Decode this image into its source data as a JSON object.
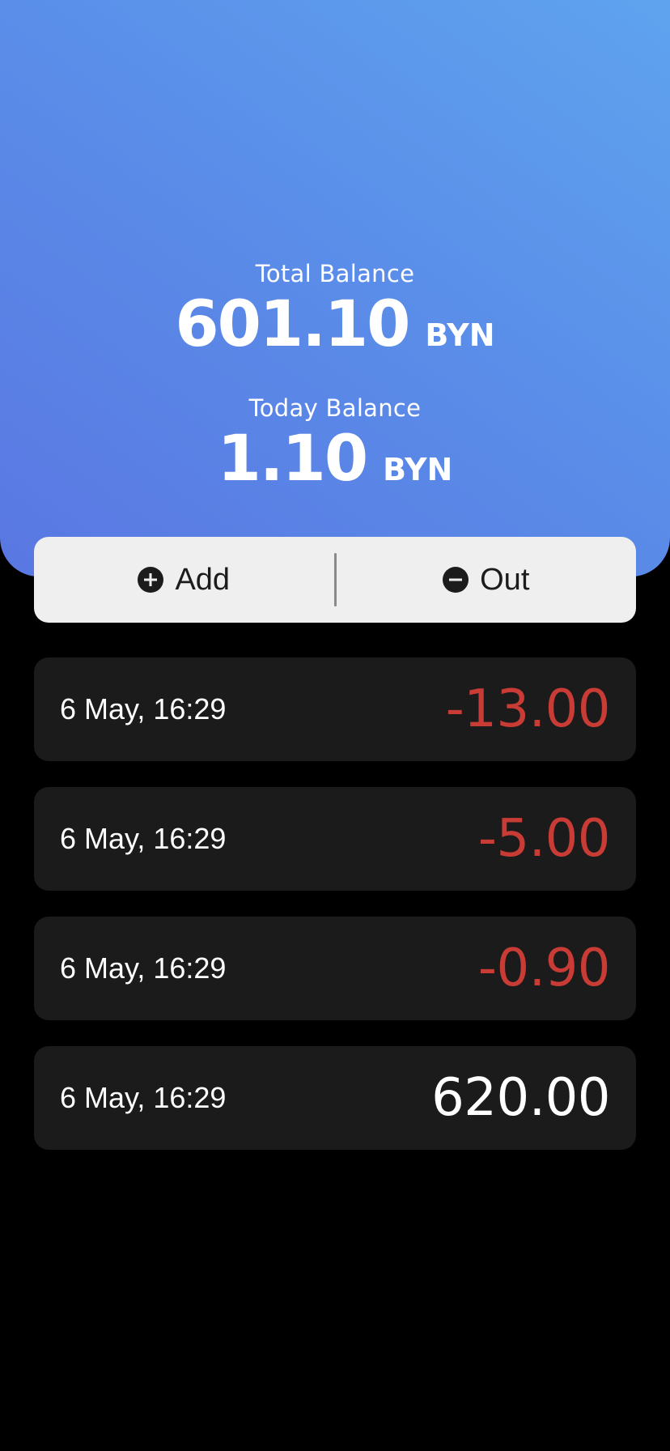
{
  "balance": {
    "total_label": "Total Balance",
    "total_amount": "601.10",
    "total_currency": "BYN",
    "today_label": "Today Balance",
    "today_amount": "1.10",
    "today_currency": "BYN"
  },
  "actions": {
    "add_label": "Add",
    "add_icon": "plus-circle-icon",
    "out_label": "Out",
    "out_icon": "minus-circle-icon"
  },
  "transactions": [
    {
      "date": "6 May, 16:29",
      "amount": "-13.00",
      "type": "expense"
    },
    {
      "date": "6 May, 16:29",
      "amount": "-5.00",
      "type": "expense"
    },
    {
      "date": "6 May, 16:29",
      "amount": "-0.90",
      "type": "expense"
    },
    {
      "date": "6 May, 16:29",
      "amount": "620.00",
      "type": "income"
    }
  ],
  "colors": {
    "header_gradient_start": "#5fa3ee",
    "header_gradient_end": "#5a77e2",
    "expense": "#c93c35",
    "income": "#ffffff",
    "card_background": "#1b1b1b",
    "action_bar_background": "#efefef"
  }
}
